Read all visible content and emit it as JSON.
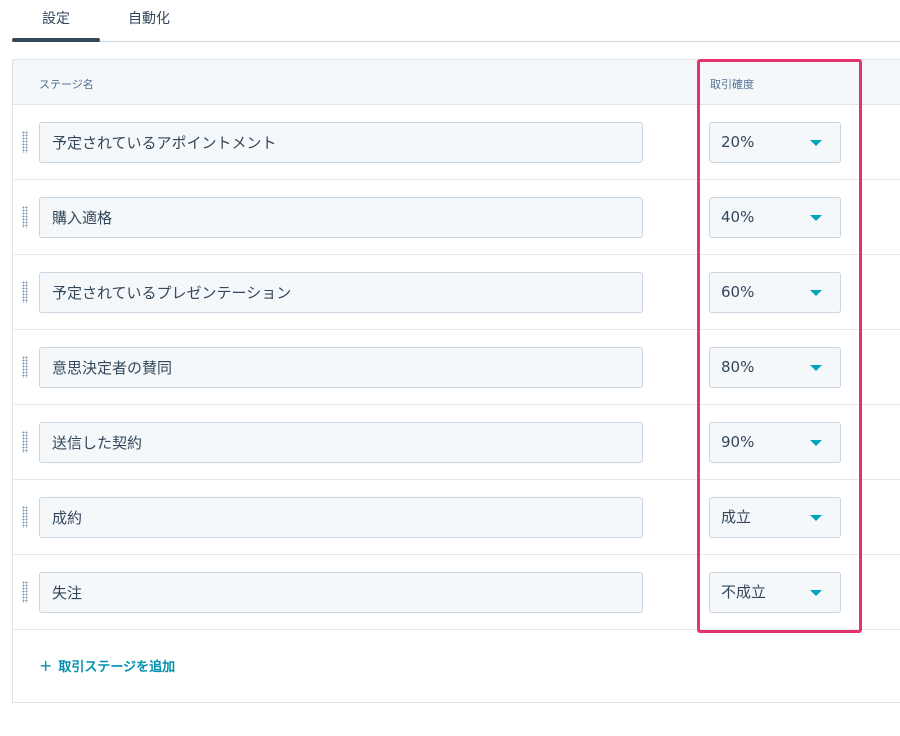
{
  "tabs": [
    {
      "label": "設定",
      "active": true
    },
    {
      "label": "自動化",
      "active": false
    }
  ],
  "table": {
    "stage_header": "ステージ名",
    "probability_header": "取引確度"
  },
  "stages": [
    {
      "name": "予定されているアポイントメント",
      "probability": "20%"
    },
    {
      "name": "購入適格",
      "probability": "40%"
    },
    {
      "name": "予定されているプレゼンテーション",
      "probability": "60%"
    },
    {
      "name": "意思決定者の賛同",
      "probability": "80%"
    },
    {
      "name": "送信した契約",
      "probability": "90%"
    },
    {
      "name": "成約",
      "probability": "成立"
    },
    {
      "name": "失注",
      "probability": "不成立"
    }
  ],
  "add_stage": {
    "icon": "+",
    "label": "取引ステージを追加"
  },
  "colors": {
    "accent": "#00a4bd",
    "link": "#0091ae",
    "highlight": "#e5336b",
    "text": "#33475b"
  }
}
